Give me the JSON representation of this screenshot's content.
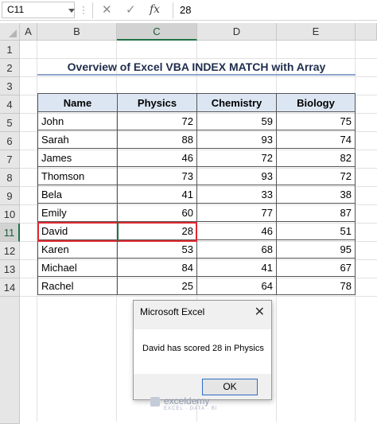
{
  "formula_bar": {
    "name_box": "C11",
    "cancel_icon": "✕",
    "enter_icon": "✓",
    "fx_label": "fx",
    "formula_value": "28"
  },
  "columns": [
    "A",
    "B",
    "C",
    "D",
    "E"
  ],
  "rows": [
    "1",
    "2",
    "3",
    "4",
    "5",
    "6",
    "7",
    "8",
    "9",
    "10",
    "11",
    "12",
    "13",
    "14"
  ],
  "title": "Overview of Excel VBA INDEX MATCH with Array",
  "table": {
    "headers": [
      "Name",
      "Physics",
      "Chemistry",
      "Biology"
    ],
    "rows": [
      [
        "John",
        "72",
        "59",
        "75"
      ],
      [
        "Sarah",
        "88",
        "93",
        "74"
      ],
      [
        "James",
        "46",
        "72",
        "82"
      ],
      [
        "Thomson",
        "73",
        "93",
        "72"
      ],
      [
        "Bela",
        "41",
        "33",
        "38"
      ],
      [
        "Emily",
        "60",
        "77",
        "87"
      ],
      [
        "David",
        "28",
        "46",
        "51"
      ],
      [
        "Karen",
        "53",
        "68",
        "95"
      ],
      [
        "Michael",
        "84",
        "41",
        "67"
      ],
      [
        "Rachel",
        "25",
        "64",
        "78"
      ]
    ]
  },
  "dialog": {
    "title": "Microsoft Excel",
    "close_icon": "✕",
    "message": "David has scored 28 in Physics",
    "ok_label": "OK"
  },
  "watermark": {
    "brand": "exceldemy",
    "tagline": "EXCEL · DATA · BI"
  },
  "colors": {
    "selection_green": "#217346",
    "highlight_red": "#e0282e",
    "header_fill": "#dce6f3"
  }
}
